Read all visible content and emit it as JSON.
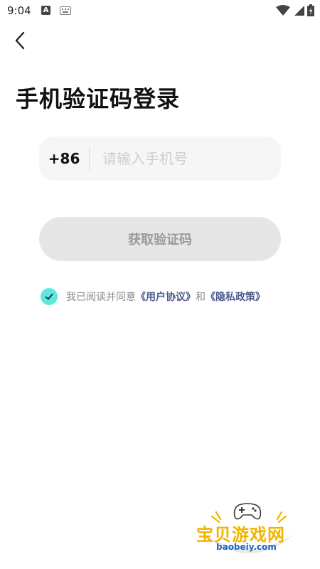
{
  "status_bar": {
    "time": "9:04",
    "a_badge": "A"
  },
  "header": {
    "title": "手机验证码登录"
  },
  "phone": {
    "country_code": "+86",
    "placeholder": "请输入手机号",
    "value": ""
  },
  "code_button": {
    "label": "获取验证码"
  },
  "agreement": {
    "checked": true,
    "prefix": "我已阅读并同意",
    "user_agreement": "《用户协议》",
    "and": "和",
    "privacy_policy": "《隐私政策》"
  },
  "watermark": {
    "title": "宝贝游戏网",
    "url": "baobeiy.com"
  },
  "colors": {
    "accent": "#5ee7dc",
    "link": "#4b5a8c",
    "button_bg": "#e6e6e6",
    "watermark": "#f1b400"
  },
  "icons": [
    "back-arrow-icon",
    "check-icon",
    "wifi-icon",
    "signal-icon",
    "battery-icon",
    "keyboard-icon",
    "gamepad-icon"
  ]
}
